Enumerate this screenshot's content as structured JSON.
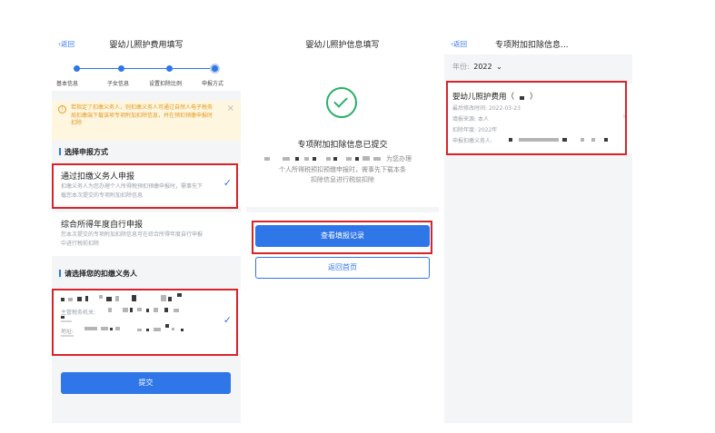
{
  "colors": {
    "accent": "#2f76e8",
    "highlight": "#d7242a",
    "warn_bg": "#fff6e0",
    "warn_text": "#e09a21"
  },
  "screen1": {
    "back_label": "返回",
    "title": "婴幼儿照护费用填写",
    "steps": [
      "基本信息",
      "子女信息",
      "设置扣除比例",
      "申报方式"
    ],
    "current_step_index": 3,
    "notice": "若指定了扣缴义务人，则扣缴义务人可通过自然人电子税务局扣缴端下载该项专项附加扣除信息，并在预扣预缴申报时扣除",
    "section_method": "选择申报方式",
    "option1_title": "通过扣缴义务人申报",
    "option1_desc": "扣缴义务人为您办理个人所得税预扣预缴申报时，需事先下载您本次提交的专项附加扣除信息",
    "option2_title": "综合所得年度自行申报",
    "option2_desc": "您本次提交的专项附加扣除信息可在综合所得年度自行申报中进行税前扣除",
    "section_employer": "请选择您的扣缴义务人",
    "tax_authority_label": "主管税务机关:",
    "address_label": "地址:",
    "submit_label": "提交"
  },
  "screen2": {
    "title": "婴幼儿照护信息填写",
    "result_title": "专项附加扣除信息已提交",
    "result_desc_1": "为您办理",
    "result_desc_2": "个人所得税预扣预缴申报时，需事先下载本条",
    "result_desc_3": "扣除信息进行税前扣除",
    "view_records_label": "查看填报记录",
    "home_label": "返回首页"
  },
  "screen3": {
    "back_label": "返回",
    "title": "专项附加扣除信息...",
    "year_label": "年份:",
    "year_value": "2022",
    "record_title": "婴幼儿照护费用（",
    "record_title_end": "）",
    "modified_label": "最后修改时间:",
    "modified_value": "2022-03-23",
    "source_label": "填报来源:",
    "source_value": "本人",
    "deduct_year_label": "扣除年度:",
    "deduct_year_value": "2022年",
    "employer_label": "申报扣缴义务人:"
  }
}
